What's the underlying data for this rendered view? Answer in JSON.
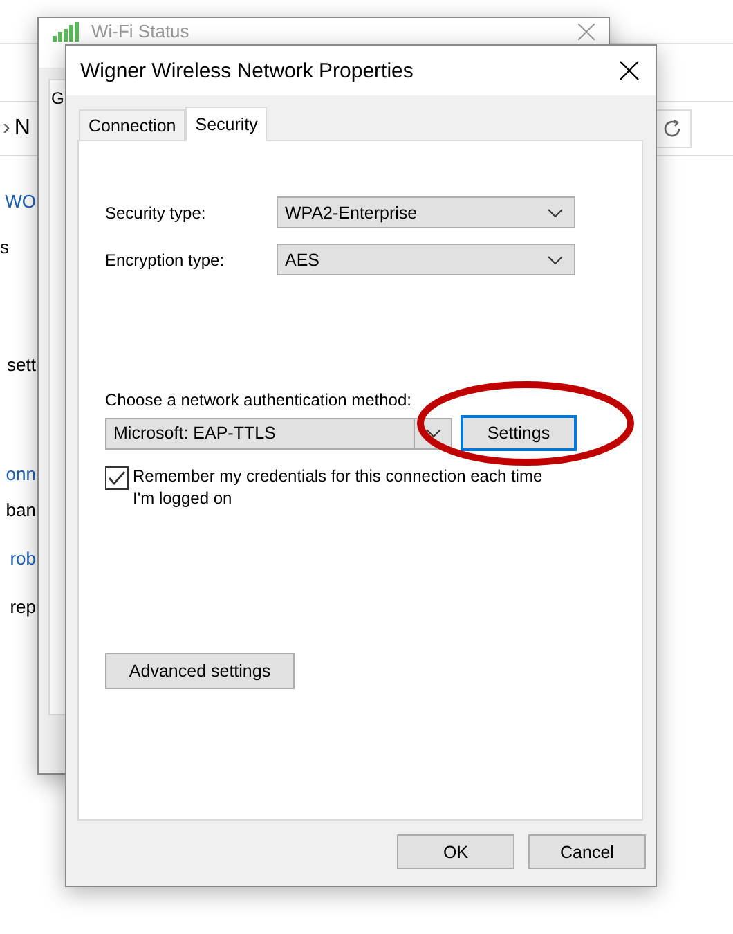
{
  "background_window": {
    "toolbar": {
      "chevron": "›",
      "breadcrumb": "N"
    },
    "fragments": [
      {
        "text": "WO",
        "kind": "link"
      },
      {
        "text": "s",
        "kind": "heading"
      },
      {
        "text": "sett",
        "kind": "text"
      },
      {
        "text": "onn",
        "kind": "link"
      },
      {
        "text": "ban",
        "kind": "text"
      },
      {
        "text": "rob",
        "kind": "link"
      },
      {
        "text": "rep",
        "kind": "text"
      }
    ]
  },
  "status_window": {
    "title": "Wi-Fi Status",
    "tabs": [
      {
        "label": "G",
        "selected": true
      }
    ]
  },
  "dialog": {
    "title": "Wigner Wireless Network Properties",
    "tabs": [
      {
        "label": "Connection",
        "selected": false
      },
      {
        "label": "Security",
        "selected": true
      }
    ],
    "fields": [
      {
        "label": "Security type:",
        "value": "WPA2-Enterprise"
      },
      {
        "label": "Encryption type:",
        "value": "AES"
      }
    ],
    "auth": {
      "label": "Choose a network authentication method:",
      "value": "Microsoft: EAP-TTLS",
      "button": "Settings"
    },
    "remember": {
      "label": "Remember my credentials for this connection each time I'm logged on",
      "checked": true
    },
    "advanced_button": "Advanced settings",
    "buttons": [
      "OK",
      "Cancel"
    ]
  }
}
